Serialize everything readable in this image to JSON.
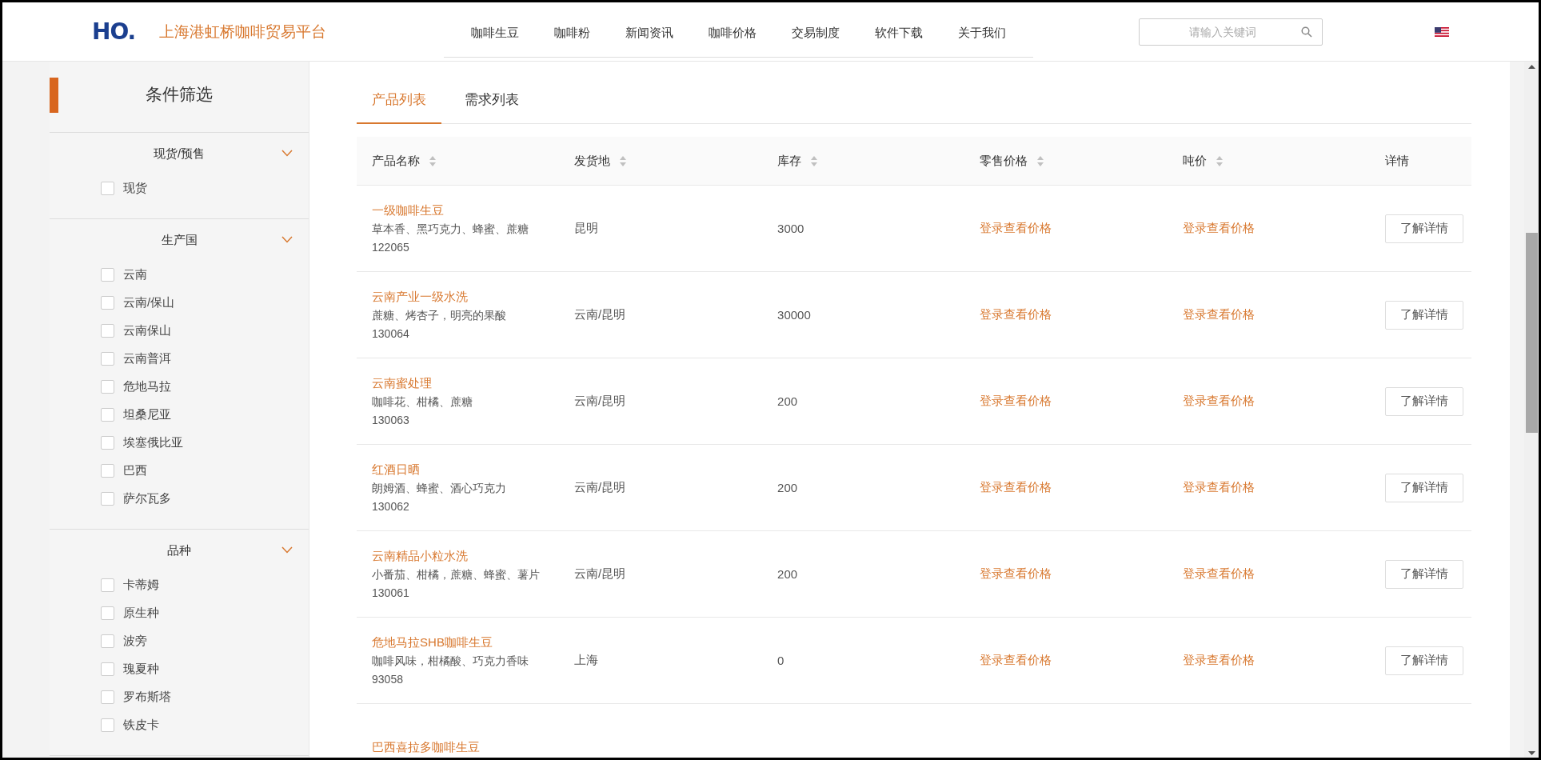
{
  "header": {
    "logo": "HO.",
    "site_title": "上海港虹桥咖啡贸易平台",
    "nav": [
      {
        "label": "咖啡生豆",
        "selected": false
      },
      {
        "label": "咖啡粉",
        "selected": false
      },
      {
        "label": "新闻资讯",
        "selected": false
      },
      {
        "label": "咖啡价格",
        "selected": false
      },
      {
        "label": "交易制度",
        "selected": false
      },
      {
        "label": "软件下载",
        "selected": false
      },
      {
        "label": "关于我们",
        "selected": false
      }
    ],
    "search": {
      "placeholder": "请输入关键词"
    }
  },
  "sidebar": {
    "title": "条件筛选",
    "groups": [
      {
        "title": "现货/预售",
        "expanded": true,
        "items": [
          {
            "label": "现货",
            "checked": false
          }
        ]
      },
      {
        "title": "生产国",
        "expanded": true,
        "items": [
          {
            "label": "云南",
            "checked": false
          },
          {
            "label": "云南/保山",
            "checked": false
          },
          {
            "label": "云南保山",
            "checked": false
          },
          {
            "label": "云南普洱",
            "checked": false
          },
          {
            "label": "危地马拉",
            "checked": false
          },
          {
            "label": "坦桑尼亚",
            "checked": false
          },
          {
            "label": "埃塞俄比亚",
            "checked": false
          },
          {
            "label": "巴西",
            "checked": false
          },
          {
            "label": "萨尔瓦多",
            "checked": false
          }
        ]
      },
      {
        "title": "品种",
        "expanded": true,
        "items": [
          {
            "label": "卡蒂姆",
            "checked": false
          },
          {
            "label": "原生种",
            "checked": false
          },
          {
            "label": "波旁",
            "checked": false
          },
          {
            "label": "瑰夏种",
            "checked": false
          },
          {
            "label": "罗布斯塔",
            "checked": false
          },
          {
            "label": "铁皮卡",
            "checked": false
          }
        ]
      }
    ]
  },
  "tabs": [
    {
      "label": "产品列表",
      "selected": true
    },
    {
      "label": "需求列表",
      "selected": false
    }
  ],
  "table": {
    "columns": [
      {
        "label": "产品名称",
        "sortable": true
      },
      {
        "label": "发货地",
        "sortable": true
      },
      {
        "label": "库存",
        "sortable": true
      },
      {
        "label": "零售价格",
        "sortable": true
      },
      {
        "label": "吨价",
        "sortable": true
      },
      {
        "label": "详情",
        "sortable": false
      }
    ],
    "rows": [
      {
        "name": "一级咖啡生豆",
        "flavor": "草本香、黑巧克力、蜂蜜、蔗糖",
        "code": "122065",
        "origin": "昆明",
        "stock": "3000",
        "retail_price": "登录查看价格",
        "ton_price": "登录查看价格",
        "action": "了解详情"
      },
      {
        "name": "云南产业一级水洗",
        "flavor": "蔗糖、烤杏子，明亮的果酸",
        "code": "130064",
        "origin": "云南/昆明",
        "stock": "30000",
        "retail_price": "登录查看价格",
        "ton_price": "登录查看价格",
        "action": "了解详情"
      },
      {
        "name": "云南蜜处理",
        "flavor": "咖啡花、柑橘、蔗糖",
        "code": "130063",
        "origin": "云南/昆明",
        "stock": "200",
        "retail_price": "登录查看价格",
        "ton_price": "登录查看价格",
        "action": "了解详情"
      },
      {
        "name": "红酒日晒",
        "flavor": "朗姆酒、蜂蜜、酒心巧克力",
        "code": "130062",
        "origin": "云南/昆明",
        "stock": "200",
        "retail_price": "登录查看价格",
        "ton_price": "登录查看价格",
        "action": "了解详情"
      },
      {
        "name": "云南精品小粒水洗",
        "flavor": "小番茄、柑橘，蔗糖、蜂蜜、薯片",
        "code": "130061",
        "origin": "云南/昆明",
        "stock": "200",
        "retail_price": "登录查看价格",
        "ton_price": "登录查看价格",
        "action": "了解详情"
      },
      {
        "name": "危地马拉SHB咖啡生豆",
        "flavor": "咖啡风味，柑橘酸、巧克力香味",
        "code": "93058",
        "origin": "上海",
        "stock": "0",
        "retail_price": "登录查看价格",
        "ton_price": "登录查看价格",
        "action": "了解详情"
      },
      {
        "name": "巴西喜拉多咖啡生豆",
        "flavor": "",
        "code": "",
        "origin": "",
        "stock": "",
        "retail_price": "",
        "ton_price": "",
        "action": ""
      }
    ]
  }
}
